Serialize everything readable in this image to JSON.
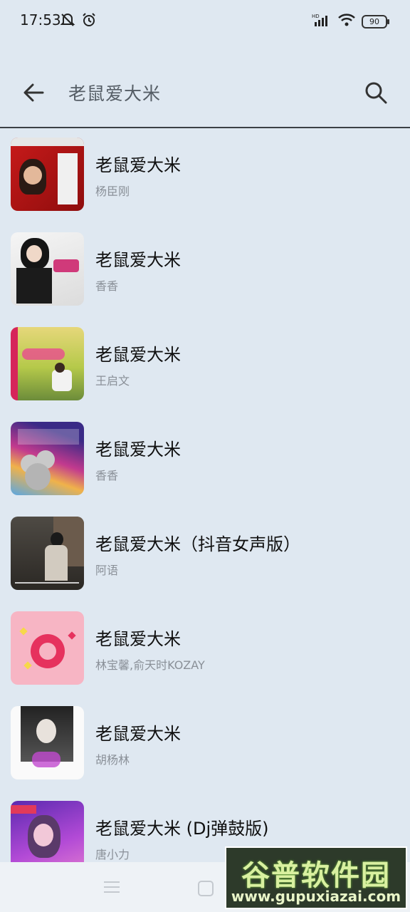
{
  "status": {
    "time": "17:53",
    "battery": "90",
    "network_badge": "HD"
  },
  "search": {
    "query": "老鼠爱大米"
  },
  "songs": [
    {
      "title": "老鼠爱大米",
      "artist": "杨臣刚"
    },
    {
      "title": "老鼠爱大米",
      "artist": "香香"
    },
    {
      "title": "老鼠爱大米",
      "artist": "王启文"
    },
    {
      "title": "老鼠爱大米",
      "artist": "香香"
    },
    {
      "title": "老鼠爱大米（抖音女声版）",
      "artist": "阿语"
    },
    {
      "title": "老鼠爱大米",
      "artist": "林宝馨,俞天时KOZAY"
    },
    {
      "title": "老鼠爱大米",
      "artist": "胡杨林"
    },
    {
      "title": "老鼠爱大米 (Dj弹鼓版)",
      "artist": "唐小力"
    }
  ],
  "watermark": {
    "title": "谷普软件园",
    "url": "www.gupuxiazai.com"
  },
  "icons": {
    "back": "back-arrow-icon",
    "search": "search-icon",
    "menu": "menu-icon",
    "home": "home-icon"
  },
  "colors": {
    "background": "#dfe8f1",
    "title": "#101010",
    "artist": "#8a9098"
  }
}
